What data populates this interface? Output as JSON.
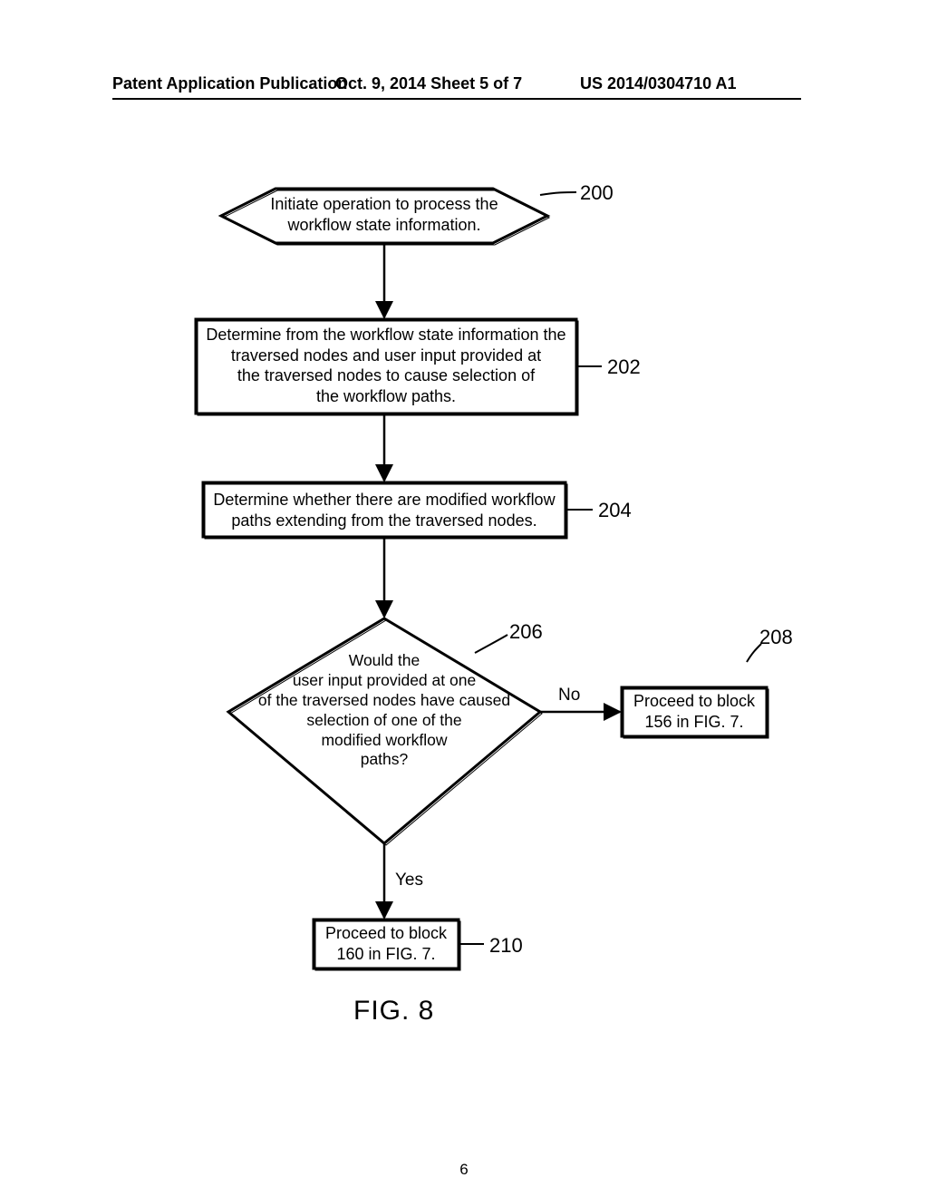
{
  "header": {
    "left": "Patent Application Publication",
    "mid": "Oct. 9, 2014   Sheet 5 of 7",
    "right": "US 2014/0304710 A1"
  },
  "figure": {
    "caption": "FIG. 8",
    "page_number": "6"
  },
  "nodes": {
    "n200": {
      "ref": "200",
      "text": "Initiate operation to process the\nworkflow state information."
    },
    "n202": {
      "ref": "202",
      "text": "Determine from the workflow state information the\ntraversed nodes and user input provided at\nthe traversed nodes to cause selection of\nthe workflow paths."
    },
    "n204": {
      "ref": "204",
      "text": "Determine whether there are modified workflow\npaths extending from the traversed nodes."
    },
    "n206": {
      "ref": "206",
      "text": "Would the\nuser input provided at one\nof the traversed nodes have caused\nselection of one of the\nmodified workflow\npaths?"
    },
    "n208": {
      "ref": "208",
      "text": "Proceed to block\n156 in FIG. 7."
    },
    "n210": {
      "ref": "210",
      "text": "Proceed to block\n160 in FIG. 7."
    }
  },
  "edges": {
    "no": "No",
    "yes": "Yes"
  },
  "chart_data": {
    "type": "flowchart",
    "title": "FIG. 8",
    "nodes": [
      {
        "id": "200",
        "shape": "terminator",
        "text": "Initiate operation to process the workflow state information."
      },
      {
        "id": "202",
        "shape": "process",
        "text": "Determine from the workflow state information the traversed nodes and user input provided at the traversed nodes to cause selection of the workflow paths."
      },
      {
        "id": "204",
        "shape": "process",
        "text": "Determine whether there are modified workflow paths extending from the traversed nodes."
      },
      {
        "id": "206",
        "shape": "decision",
        "text": "Would the user input provided at one of the traversed nodes have caused selection of one of the modified workflow paths?"
      },
      {
        "id": "208",
        "shape": "process",
        "text": "Proceed to block 156 in FIG. 7."
      },
      {
        "id": "210",
        "shape": "process",
        "text": "Proceed to block 160 in FIG. 7."
      }
    ],
    "edges": [
      {
        "from": "200",
        "to": "202",
        "label": ""
      },
      {
        "from": "202",
        "to": "204",
        "label": ""
      },
      {
        "from": "204",
        "to": "206",
        "label": ""
      },
      {
        "from": "206",
        "to": "208",
        "label": "No"
      },
      {
        "from": "206",
        "to": "210",
        "label": "Yes"
      }
    ]
  }
}
